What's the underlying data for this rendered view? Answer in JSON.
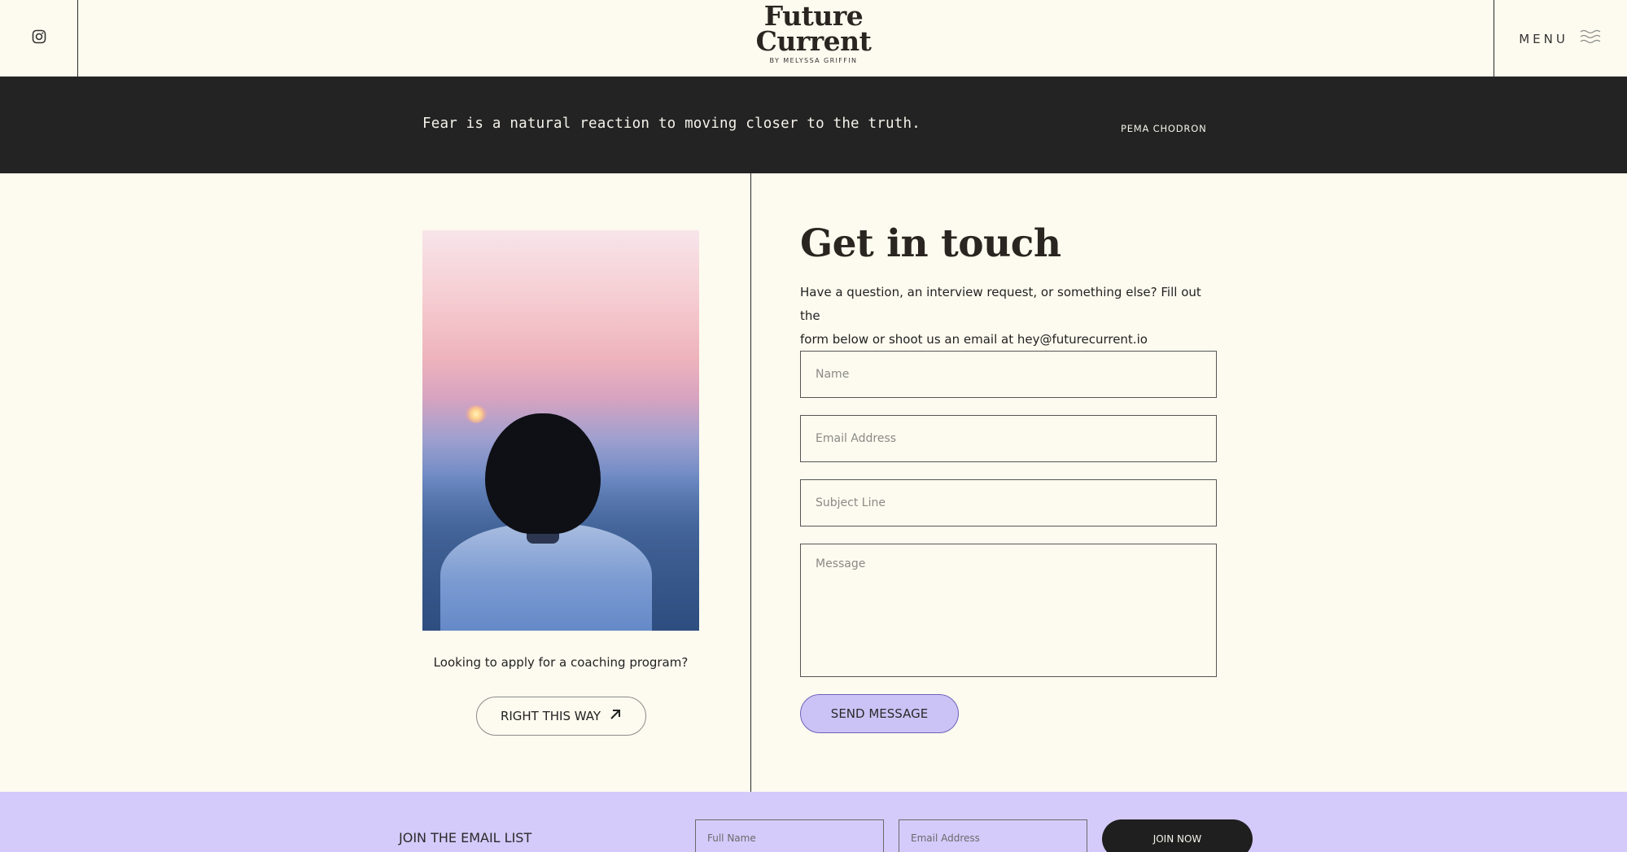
{
  "header": {
    "logo_line1": "Future",
    "logo_line2": "Current",
    "logo_by": "BY MELYSSA GRIFFIN",
    "menu_label": "MENU",
    "instagram_icon": "instagram-icon",
    "menu_icon": "wave-menu-icon"
  },
  "quote": {
    "text": "Fear is a natural reaction to moving closer to the truth.",
    "author": "PEMA CHODRON"
  },
  "left": {
    "coaching_text": "Looking to apply for a coaching program?",
    "cta_label": "RIGHT THIS WAY",
    "cta_icon": "arrow-up-right-icon"
  },
  "contact": {
    "title": "Get in touch",
    "description_line1": "Have a question, an interview request, or something else? Fill out the",
    "description_line2": "form below or shoot us an email at hey@futurecurrent.io",
    "name_placeholder": "Name",
    "email_placeholder": "Email Address",
    "subject_placeholder": "Subject Line",
    "message_placeholder": "Message",
    "send_label": "SEND MESSAGE"
  },
  "email_list": {
    "label": "JOIN THE EMAIL LIST",
    "fullname_placeholder": "Full Name",
    "email_placeholder": "Email Address",
    "join_label": "JOIN NOW"
  },
  "colors": {
    "background": "#fdfbef",
    "quote_band": "#232323",
    "accent_lavender": "#cbc3f6",
    "footer_band": "#d4cbfa"
  }
}
